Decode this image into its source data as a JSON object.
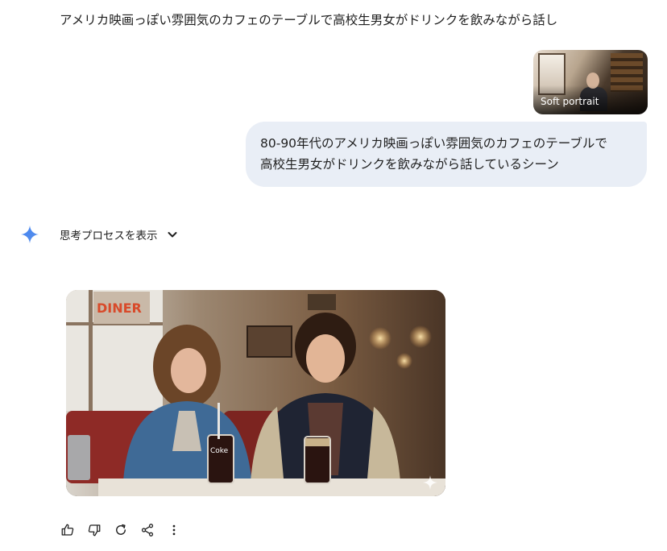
{
  "conversation": {
    "previous_prompt_truncated": "アメリカ映画っぽい雰囲気のカフェのテーブルで高校生男女がドリンクを飲みながら話し",
    "attachment": {
      "label": "Soft portrait"
    },
    "user_message": {
      "line1": "80-90年代のアメリカ映画っぽい雰囲気のカフェのテーブルで",
      "line2": "高校生男女がドリンクを飲みながら話しているシーン"
    },
    "response": {
      "show_thinking_label": "思考プロセスを表示",
      "image": {
        "cup_brand_text": "Coke",
        "sign_text": "DINER"
      }
    },
    "actions": [
      "thumbs-up",
      "thumbs-down",
      "regenerate",
      "share",
      "more"
    ]
  },
  "colors": {
    "user_bubble_bg": "#e9eef6",
    "text": "#1f1f1f",
    "gemini_gradient_start": "#4285f4",
    "gemini_gradient_end": "#5a8fe8"
  }
}
